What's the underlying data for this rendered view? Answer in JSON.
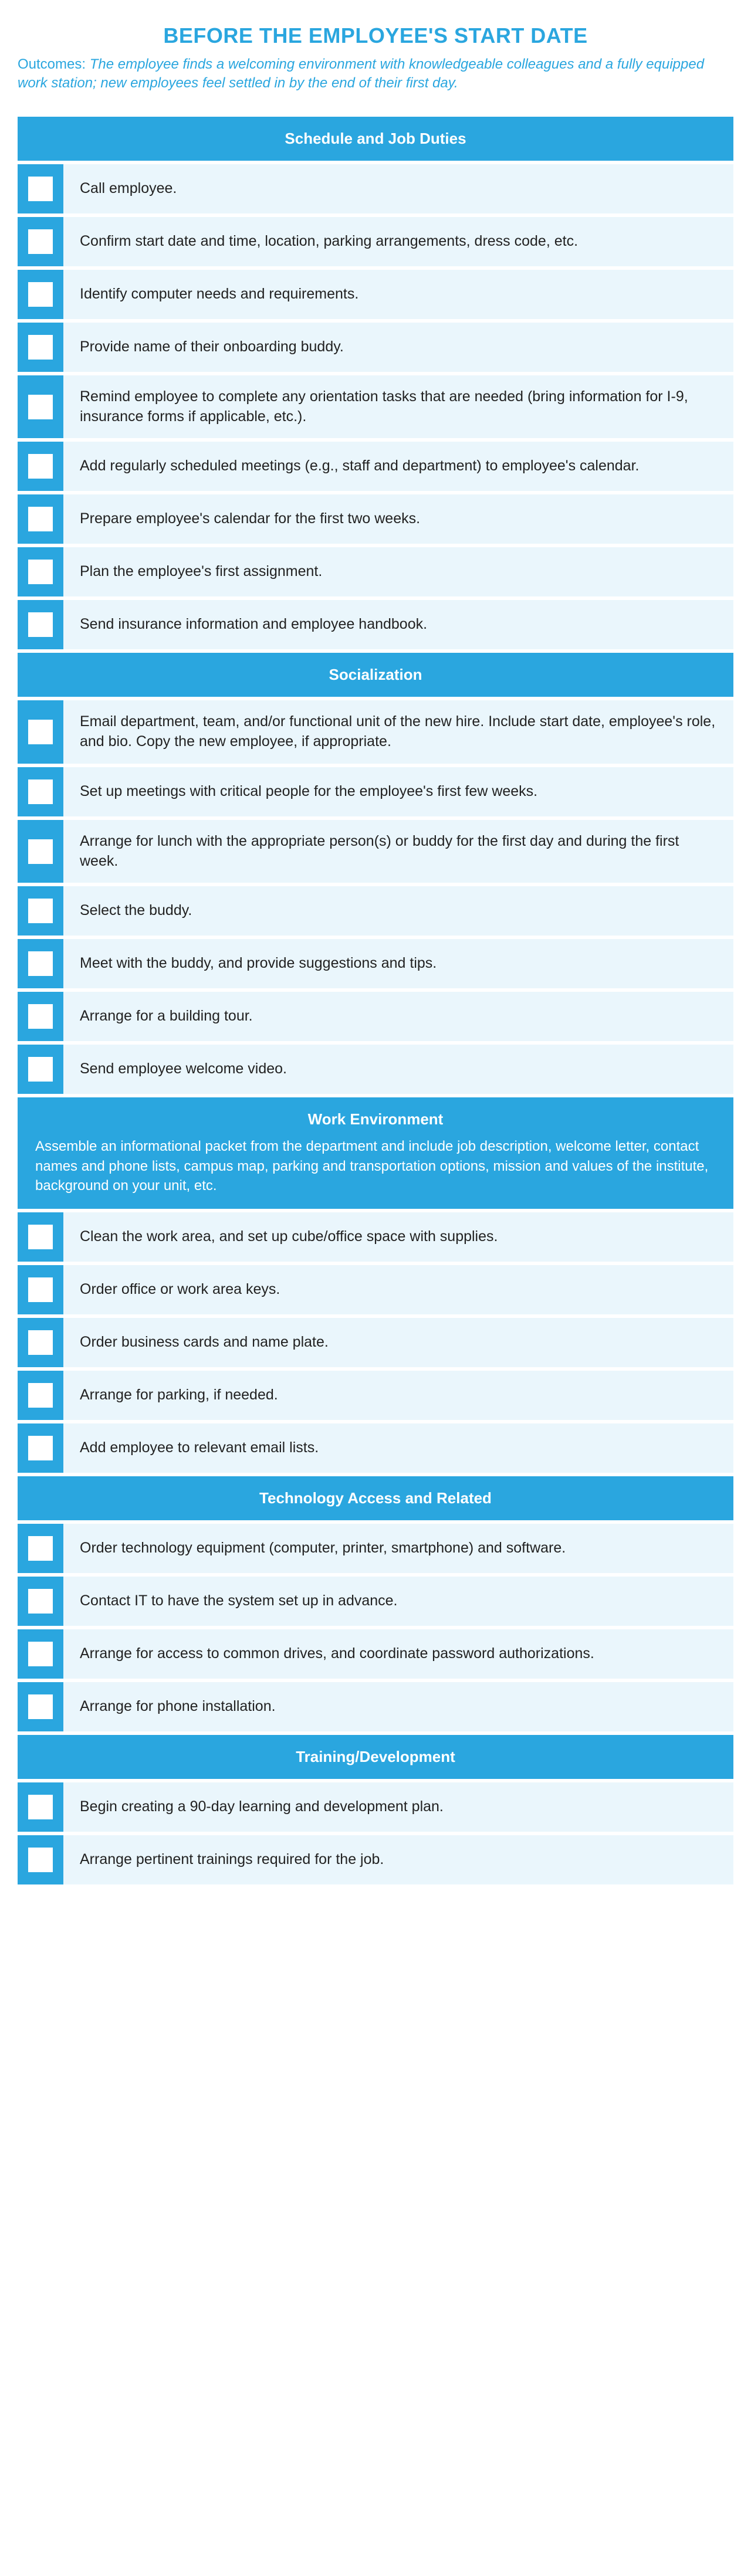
{
  "title": "BEFORE THE EMPLOYEE'S START DATE",
  "outcomes_label": "Outcomes: ",
  "outcomes_text": "The employee finds a welcoming environment with knowledgeable colleagues and a fully equipped work station; new employees feel settled in by the end of their first day.",
  "sections": {
    "schedule": {
      "title": "Schedule and Job Duties",
      "items": [
        "Call employee.",
        "Confirm start date and time, location, parking arrangements, dress code, etc.",
        "Identify computer needs and requirements.",
        "Provide name of their onboarding buddy.",
        "Remind employee to complete any orientation tasks that are needed (bring information for I-9, insurance forms if applicable, etc.).",
        "Add regularly scheduled meetings (e.g., staff and department) to employee's calendar.",
        "Prepare employee's calendar for the first two weeks.",
        "Plan the employee's first assignment.",
        "Send insurance information and employee handbook."
      ]
    },
    "socialization": {
      "title": "Socialization",
      "items": [
        "Email department, team, and/or functional unit of the new hire. Include start date, employee's role, and bio. Copy the new employee, if appropriate.",
        "Set up meetings with critical people for the employee's first few weeks.",
        "Arrange for lunch with the appropriate person(s) or buddy for the first day and during the first week.",
        "Select the buddy.",
        "Meet with the buddy, and provide suggestions and tips.",
        "Arrange for a building tour.",
        "Send employee welcome video."
      ]
    },
    "work_env": {
      "title": "Work Environment",
      "desc": "Assemble an informational packet from the department and include job description, welcome letter, contact names and phone lists, campus map, parking and transportation options, mission and values of the institute, background on your unit, etc.",
      "items": [
        "Clean the work area, and set up cube/office space with supplies.",
        "Order office or work area keys.",
        "Order business cards and name plate.",
        "Arrange for parking, if needed.",
        "Add employee to relevant email lists."
      ]
    },
    "tech": {
      "title": "Technology Access and Related",
      "items": [
        "Order technology equipment (computer, printer, smartphone) and software.",
        "Contact IT to have the system set up in advance.",
        "Arrange for access to common drives, and coordinate password authorizations.",
        "Arrange for phone installation."
      ]
    },
    "training": {
      "title": "Training/Development",
      "items": [
        "Begin creating a 90-day learning and development plan.",
        "Arrange pertinent trainings required for the job."
      ]
    }
  }
}
